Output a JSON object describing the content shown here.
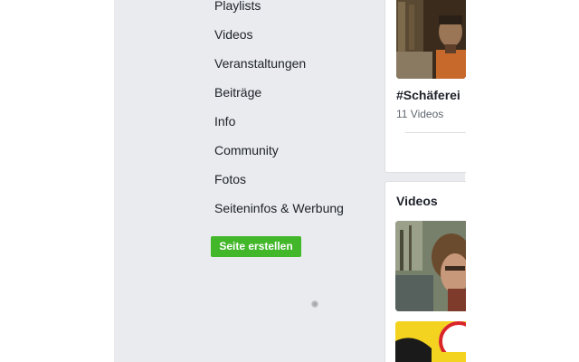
{
  "nav": {
    "items": [
      {
        "label": "Playlists"
      },
      {
        "label": "Videos"
      },
      {
        "label": "Veranstaltungen"
      },
      {
        "label": "Beiträge"
      },
      {
        "label": "Info"
      },
      {
        "label": "Community"
      },
      {
        "label": "Fotos"
      },
      {
        "label": "Seiteninfos & Werbung"
      }
    ],
    "create_page_label": "Seite erstellen"
  },
  "playlist_card": {
    "title": "#Schäferei",
    "count": "11 Videos"
  },
  "videos_card": {
    "title": "Videos"
  },
  "colors": {
    "background_gray": "#e9ebee",
    "button_green": "#42b72a",
    "text_dark": "#1d2129",
    "text_muted": "#606770"
  }
}
